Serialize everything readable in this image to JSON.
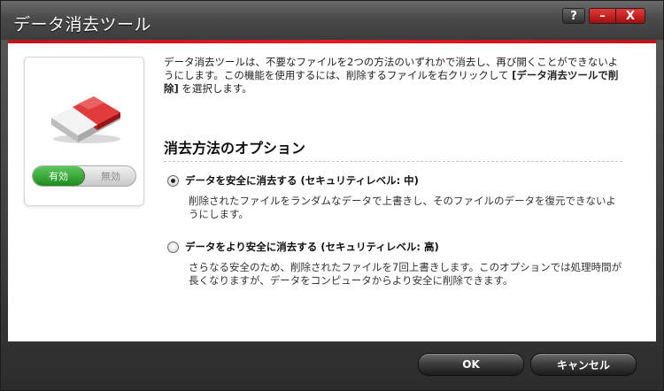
{
  "window": {
    "title": "データ消去ツール",
    "help_label": "?",
    "minimize_label": "–",
    "close_label": "X",
    "accent_color": "#e21a23"
  },
  "icon_panel": {
    "icon": "eraser-icon",
    "toggle": {
      "on_label": "有効",
      "off_label": "無効",
      "state": "on"
    }
  },
  "description": {
    "text_part1": "データ消去ツールは、不要なファイルを2つの方法のいずれかで消去し、再び開くことができないようにします。この機能を使用するには、削除するファイルを右クリックして ",
    "bold_part": "[データ消去ツールで削除]",
    "text_part2": " を選択します。"
  },
  "options_section": {
    "title": "消去方法のオプション",
    "options": [
      {
        "label": "データを安全に消去する (セキュリティレベル: 中)",
        "description": "削除されたファイルをランダムなデータで上書きし、そのファイルのデータを復元できないようにします。",
        "selected": true
      },
      {
        "label": "データをより安全に消去する (セキュリティレベル: 高)",
        "description": "さらなる安全のため、削除されたファイルを7回上書きします。このオプションでは処理時間が長くなりますが、データをコンピュータからより安全に削除できます。",
        "selected": false
      }
    ]
  },
  "footer": {
    "ok_label": "OK",
    "cancel_label": "キャンセル"
  }
}
